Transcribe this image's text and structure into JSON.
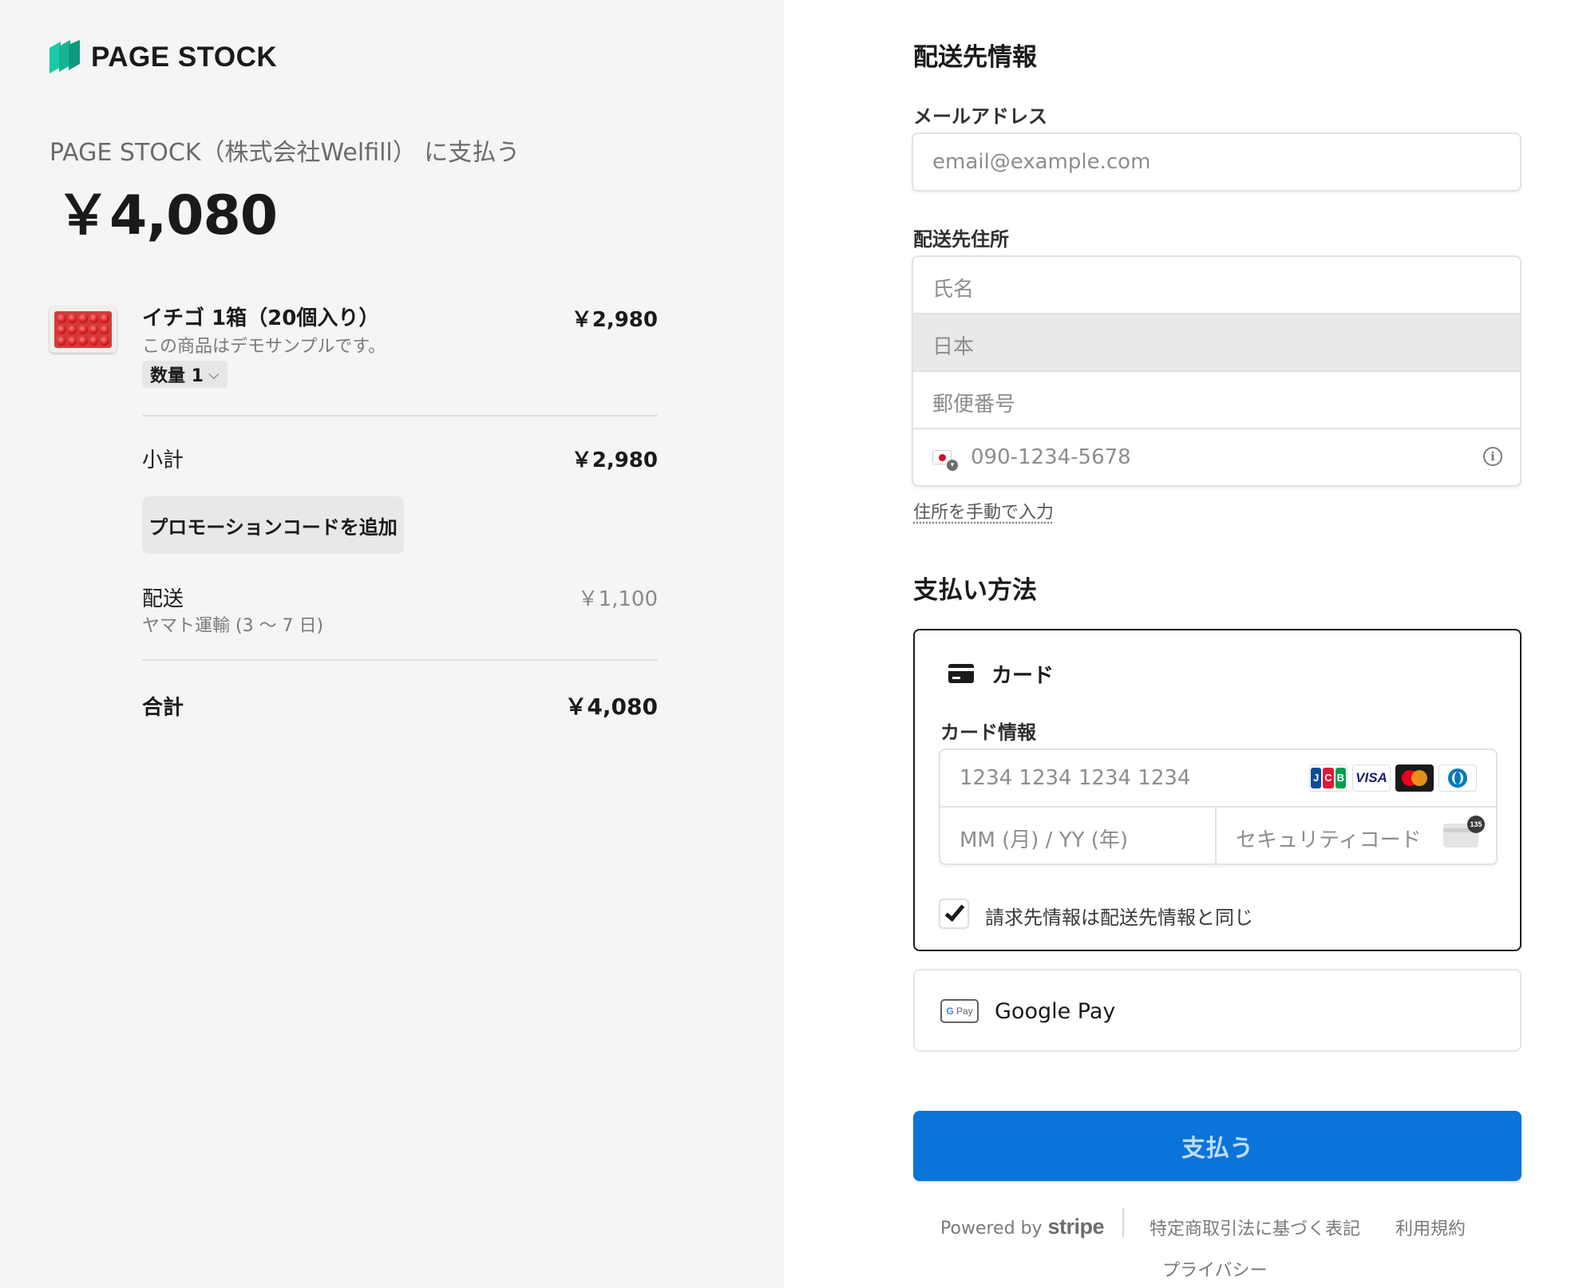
{
  "brand": {
    "name": "PAGE STOCK",
    "accent_colors": [
      "#1cc9a8",
      "#0e9a7e"
    ]
  },
  "summary": {
    "pay_to": "PAGE STOCK（株式会社Welfill） に支払う",
    "total_amount": "￥4,080"
  },
  "line_item": {
    "name": "イチゴ 1箱（20個入り）",
    "description": "この商品はデモサンプルです。",
    "quantity_label": "数量 1",
    "price": "￥2,980"
  },
  "totals": {
    "subtotal_label": "小計",
    "subtotal_value": "￥2,980",
    "promo_button": "プロモーションコードを追加",
    "shipping_label": "配送",
    "shipping_method": "ヤマト運輸 (3 ～ 7 日)",
    "shipping_value": "￥1,100",
    "total_label": "合計",
    "total_value": "￥4,080"
  },
  "shipping_info": {
    "heading": "配送先情報",
    "email_label": "メールアドレス",
    "email_placeholder": "email@example.com",
    "address_label": "配送先住所",
    "name_placeholder": "氏名",
    "country_value": "日本",
    "postal_placeholder": "郵便番号",
    "phone_placeholder": "090-1234-5678",
    "manual_link": "住所を手動で入力"
  },
  "payment": {
    "heading": "支払い方法",
    "card_tab_label": "カード",
    "card_info_label": "カード情報",
    "card_number_placeholder": "1234 1234 1234 1234",
    "expiry_placeholder": "MM (月) / YY (年)",
    "cvc_placeholder": "セキュリティコード",
    "cvc_badge": "135",
    "card_brands": [
      "jcb",
      "visa",
      "mastercard",
      "diners"
    ],
    "visa_text": "VISA",
    "billing_same_label": "請求先情報は配送先情報と同じ",
    "billing_same_checked": true,
    "gpay_label": "Google Pay",
    "gpay_icon_text": "Pay",
    "submit_label": "支払う",
    "submit_color": "#0a74da"
  },
  "footer": {
    "powered_by": "Powered by",
    "stripe": "stripe",
    "link_tokushoho": "特定商取引法に基づく表記",
    "link_terms": "利用規約",
    "link_privacy": "プライバシー"
  }
}
